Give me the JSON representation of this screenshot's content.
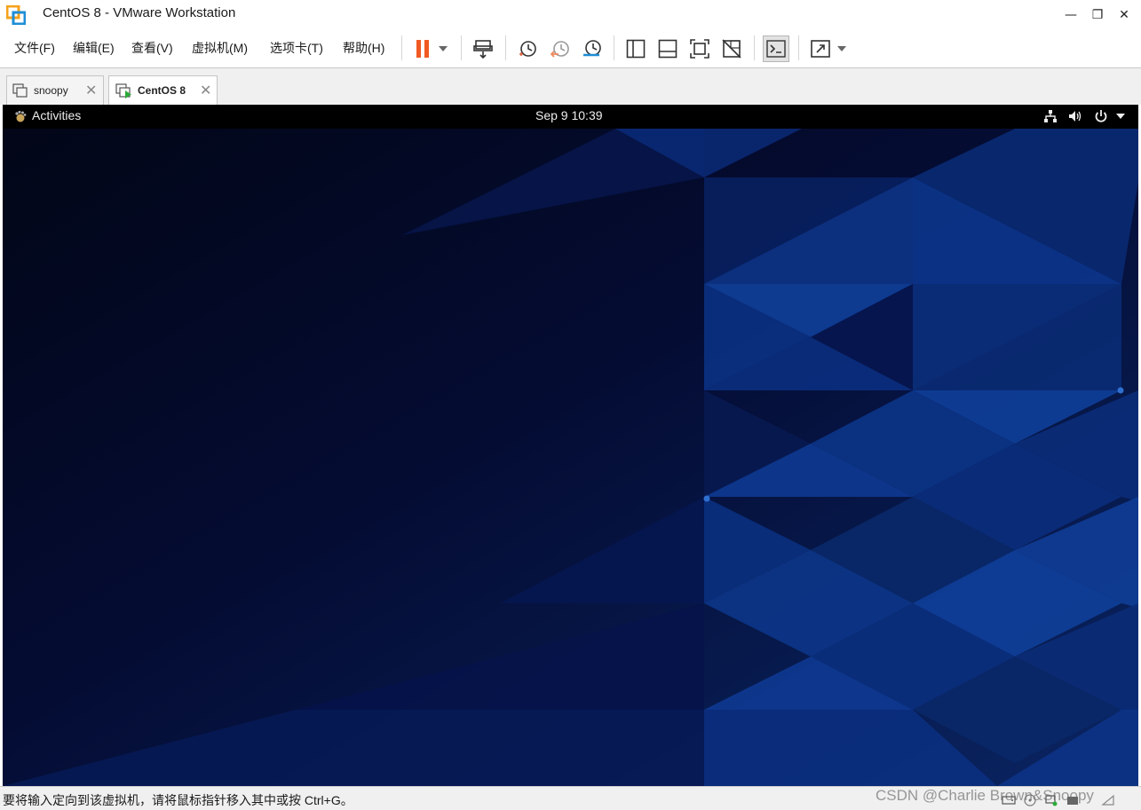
{
  "window": {
    "title": "CentOS 8 - VMware Workstation",
    "minimize_glyph": "—",
    "restore_glyph": "❐",
    "close_glyph": "✕"
  },
  "menu": {
    "items": [
      {
        "label": "文件(F)"
      },
      {
        "label": "编辑(E)"
      },
      {
        "label": "查看(V)"
      },
      {
        "label": "虚拟机(M)"
      },
      {
        "label": "选项卡(T)"
      },
      {
        "label": "帮助(H)"
      }
    ]
  },
  "toolbar": {
    "icons": [
      "pause-icon",
      "dropdown-arrow-icon",
      "send-ctrl-alt-del-icon",
      "snapshot-take-icon",
      "snapshot-revert-icon",
      "snapshot-manager-icon",
      "sidebar-toggle-icon",
      "thumbnail-bar-icon",
      "fit-guest-icon",
      "unity-icon",
      "console-view-icon",
      "fullscreen-icon",
      "fullscreen-dropdown-icon"
    ],
    "accent_color": "#f05a22"
  },
  "tabs": [
    {
      "label": "snoopy",
      "active": false,
      "close": "✕"
    },
    {
      "label": "CentOS 8",
      "active": true,
      "close": "✕"
    }
  ],
  "guest": {
    "activities": "Activities",
    "clock": "Sep 9  10:39",
    "tray_icons": [
      "network-icon",
      "volume-icon",
      "power-icon",
      "system-menu-arrow-icon"
    ],
    "wallpaper_colors": [
      "#040a2a",
      "#0a2a78",
      "#0f3f9a"
    ]
  },
  "status": {
    "message": "要将输入定向到该虚拟机，请将鼠标指针移入其中或按 Ctrl+G。",
    "watermark": "CSDN @Charlie Brown&Snoopy",
    "device_icons": [
      "hard-disk-icon",
      "cd-rom-icon",
      "network-adapter-icon",
      "usb-icon",
      "sound-card-icon"
    ]
  }
}
